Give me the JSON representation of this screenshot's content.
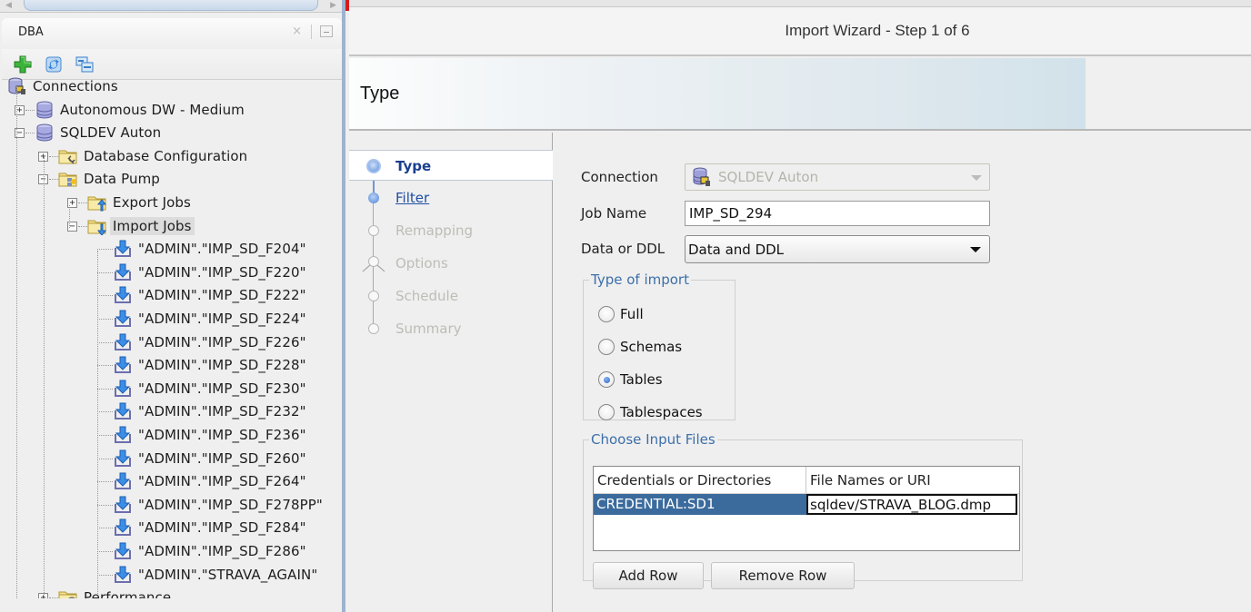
{
  "left_panel": {
    "title": "DBA",
    "close_glyph": "×",
    "toolbar": [
      {
        "name": "add-connection",
        "icon": "green-plus-icon"
      },
      {
        "name": "refresh",
        "icon": "refresh-icon"
      },
      {
        "name": "collapse-all",
        "icon": "collapse-icon"
      }
    ],
    "tree": {
      "root": "Connections",
      "connections": [
        {
          "label": "Autonomous DW - Medium",
          "expanded": false
        },
        {
          "label": "SQLDEV Auton",
          "expanded": true
        }
      ],
      "sqldev_children": [
        {
          "label": "Database Configuration",
          "expanded": false
        },
        {
          "label": "Data Pump",
          "expanded": true
        },
        {
          "label": "Performance",
          "expanded": false
        }
      ],
      "data_pump_children": [
        {
          "label": "Export Jobs",
          "expanded": false
        },
        {
          "label": "Import Jobs",
          "expanded": true,
          "selected": true
        }
      ],
      "import_jobs": [
        "\"ADMIN\".\"IMP_SD_F204\"",
        "\"ADMIN\".\"IMP_SD_F220\"",
        "\"ADMIN\".\"IMP_SD_F222\"",
        "\"ADMIN\".\"IMP_SD_F224\"",
        "\"ADMIN\".\"IMP_SD_F226\"",
        "\"ADMIN\".\"IMP_SD_F228\"",
        "\"ADMIN\".\"IMP_SD_F230\"",
        "\"ADMIN\".\"IMP_SD_F232\"",
        "\"ADMIN\".\"IMP_SD_F236\"",
        "\"ADMIN\".\"IMP_SD_F260\"",
        "\"ADMIN\".\"IMP_SD_F264\"",
        "\"ADMIN\".\"IMP_SD_F278PP\"",
        "\"ADMIN\".\"IMP_SD_F284\"",
        "\"ADMIN\".\"IMP_SD_F286\"",
        "\"ADMIN\".\"STRAVA_AGAIN\""
      ]
    }
  },
  "wizard": {
    "title": "Import Wizard - Step 1 of 6",
    "heading": "Type",
    "steps": [
      {
        "label": "Type",
        "state": "active"
      },
      {
        "label": "Filter",
        "state": "link"
      },
      {
        "label": "Remapping",
        "state": "disabled"
      },
      {
        "label": "Options",
        "state": "disabled"
      },
      {
        "label": "Schedule",
        "state": "disabled"
      },
      {
        "label": "Summary",
        "state": "disabled"
      }
    ],
    "form": {
      "connection_label": "Connection",
      "connection_value": "SQLDEV Auton",
      "job_name_label": "Job Name",
      "job_name_value": "IMP_SD_294",
      "data_or_ddl_label": "Data or DDL",
      "data_or_ddl_value": "Data and DDL",
      "type_of_import": {
        "legend": "Type of import",
        "options": [
          "Full",
          "Schemas",
          "Tables",
          "Tablespaces"
        ],
        "selected": "Tables"
      },
      "input_files": {
        "legend": "Choose Input Files",
        "columns": [
          "Credentials or Directories",
          "File Names or URI"
        ],
        "rows": [
          [
            "CREDENTIAL:SD1",
            "sqldev/STRAVA_BLOG.dmp"
          ]
        ],
        "add_row_label": "Add Row",
        "remove_row_label": "Remove Row"
      }
    }
  },
  "colors": {
    "selected_cell": "#3b6b9d",
    "active_step_text": "#1a3f8f",
    "link_step_text": "#1f4ea3",
    "disabled_step_text": "#bdbdb6",
    "legend_text": "#3c6fa9"
  }
}
